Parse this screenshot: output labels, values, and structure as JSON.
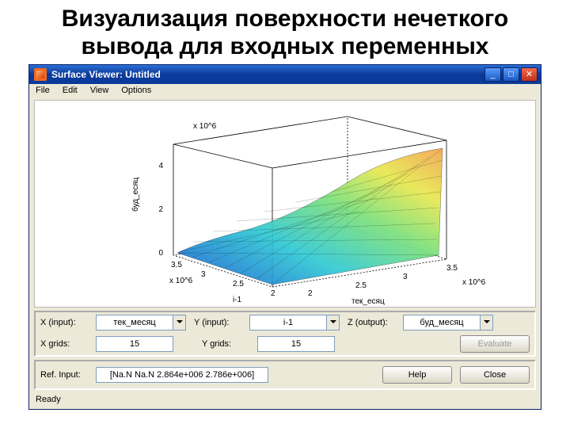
{
  "slide": {
    "title": "Визуализация поверхности нечеткого вывода для входных переменных"
  },
  "window": {
    "title": "Surface Viewer: Untitled",
    "menus": {
      "file": "File",
      "edit": "Edit",
      "view": "View",
      "options": "Options"
    },
    "status": "Ready"
  },
  "controls": {
    "xinput_label": "X (input):",
    "xinput_value": "тек_месяц",
    "yinput_label": "Y (input):",
    "yinput_value": "i-1",
    "zoutput_label": "Z (output):",
    "zoutput_value": "буд_месяц",
    "xgrids_label": "X grids:",
    "xgrids_value": "15",
    "ygrids_label": "Y grids:",
    "ygrids_value": "15",
    "evaluate": "Evaluate",
    "refinput_label": "Ref. Input:",
    "refinput_value": "[Na.N Na.N 2.864e+006 2.786e+006]",
    "help": "Help",
    "close": "Close"
  },
  "chart_data": {
    "type": "surface",
    "title": "",
    "xlabel": "i-1",
    "ylabel": "тек_есяц",
    "zlabel": "буд_есяц",
    "x_scale": "x 10^6",
    "y_scale": "x 10^6",
    "z_scale": "x 10^6",
    "x_ticks": [
      2,
      2.5,
      3,
      3.5
    ],
    "y_ticks": [
      2,
      2.5,
      3,
      3.5
    ],
    "z_ticks": [
      0,
      2,
      4
    ],
    "xlim": [
      2.0,
      3.5
    ],
    "ylim": [
      2.0,
      3.5
    ],
    "zlim": [
      0,
      5
    ],
    "grid_resolution": [
      15,
      15
    ],
    "note": "Z values estimated visually from rendered surface shading/height; surface rises from near 0 at (x≈2, y≈2) toward ~4–4.5 near (x≈3.5, y≈3.5). Output = буд_месяц (next month) vs inputs тек_месяц (current month) and i-1.",
    "colormap": "jet-like (blue→cyan→yellow→orange)"
  }
}
